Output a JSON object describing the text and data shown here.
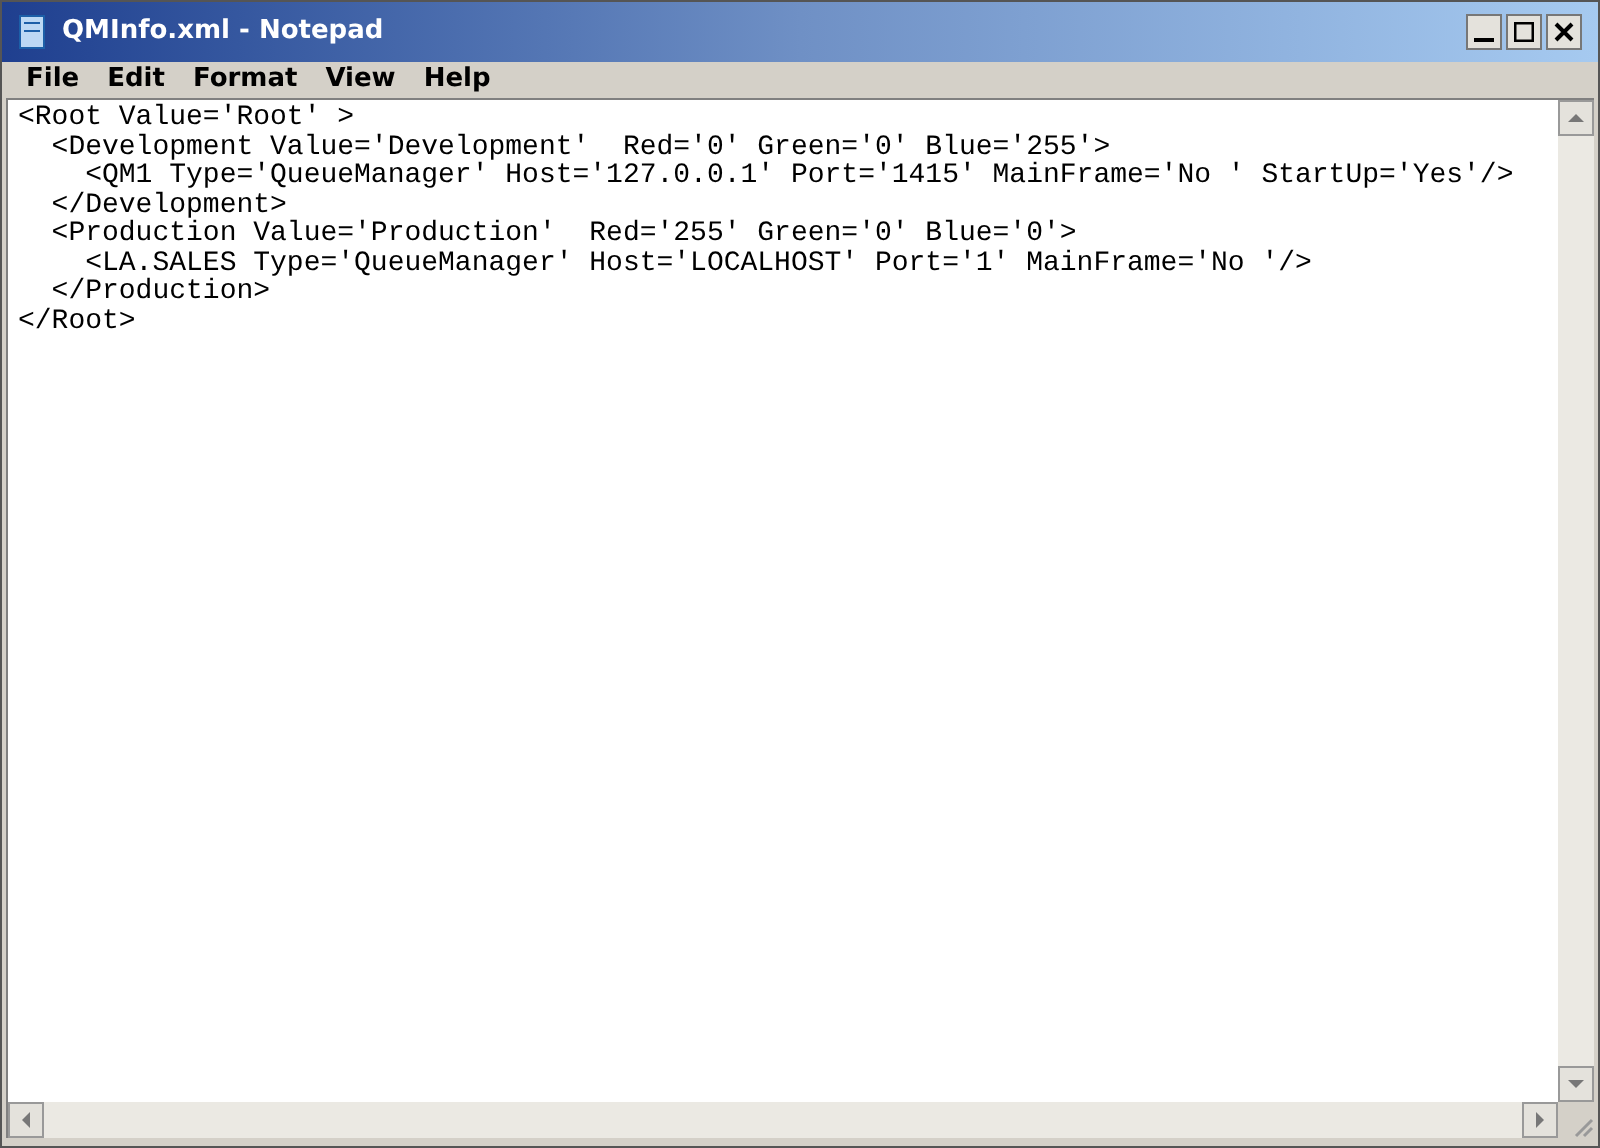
{
  "window": {
    "title": "QMInfo.xml - Notepad"
  },
  "menu": [
    "File",
    "Edit",
    "Format",
    "View",
    "Help"
  ],
  "lines": [
    "<Root Value='Root' >",
    "  <Development Value='Development'  Red='0' Green='0' Blue='255'>",
    "    <QM1 Type='QueueManager' Host='127.0.0.1' Port='1415' MainFrame='No ' StartUp='Yes'/>",
    "  </Development>",
    "  <Production Value='Production'  Red='255' Green='0' Blue='0'>",
    "    <LA.SALES Type='QueueManager' Host='LOCALHOST' Port='1' MainFrame='No '/>",
    "  </Production>",
    "</Root>"
  ]
}
